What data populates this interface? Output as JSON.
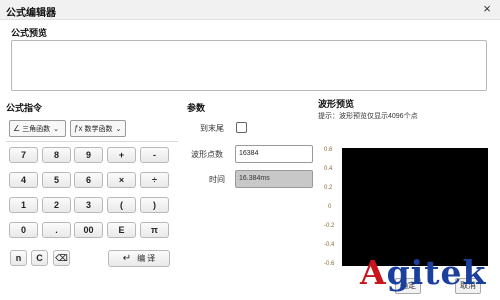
{
  "window": {
    "title": "公式编辑器",
    "close_glyph": "×"
  },
  "formula_preview": {
    "label": "公式预览"
  },
  "instructions": {
    "label": "公式指令",
    "dropdowns": [
      {
        "icon": "∠",
        "label": "三角函数"
      },
      {
        "icon": "ƒx",
        "label": "数学函数"
      }
    ],
    "keys": [
      [
        "7",
        "8",
        "9",
        "+",
        "-"
      ],
      [
        "4",
        "5",
        "6",
        "×",
        "÷"
      ],
      [
        "1",
        "2",
        "3",
        "(",
        ")"
      ],
      [
        "0",
        ".",
        "00",
        "E",
        "π"
      ]
    ],
    "extra_keys": [
      "n",
      "C",
      "⌫"
    ],
    "translate": {
      "icon": "↵",
      "label": "编 译"
    }
  },
  "params": {
    "label": "参数",
    "to_end_label": "到末尾",
    "points_label": "波形点数",
    "points_value": "16384",
    "time_label": "时间",
    "time_value": "16.384ms"
  },
  "waveform": {
    "label": "波形预览",
    "hint": "提示：波形预览仅显示4096个点",
    "y_ticks": [
      "0.6",
      "0.4",
      "0.2",
      "0",
      "-0.2",
      "-0.4",
      "-0.6"
    ]
  },
  "logo": {
    "text_first": "A",
    "text_rest": "gitek"
  },
  "bottom_buttons": [
    "确定",
    "取消"
  ]
}
